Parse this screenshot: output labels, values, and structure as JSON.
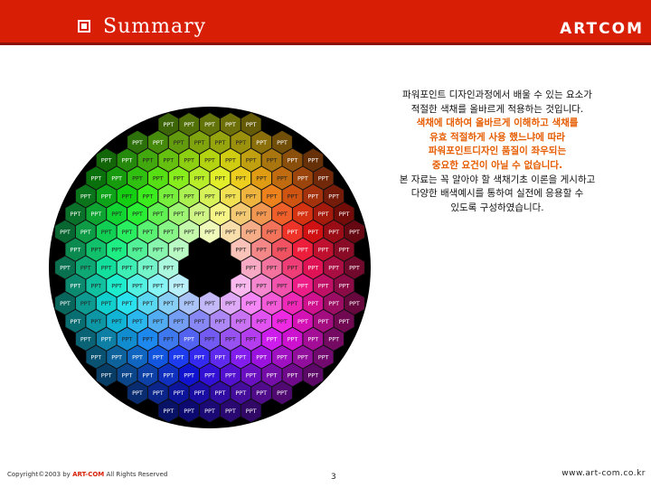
{
  "slide": {
    "title": "Summary",
    "brand": "ARTCOM",
    "cell_label": "PPT"
  },
  "summary": {
    "lines": [
      {
        "text": "파워포인트 디자인과정에서 배울 수 있는 요소가",
        "highlight": false
      },
      {
        "text": "적절한 색채를 올바르게 적용하는 것입니다.",
        "highlight": false
      },
      {
        "text": "색채에 대하여 올바르게 이해하고 색채를",
        "highlight": true
      },
      {
        "text": "유효 적절하게 사용 했느냐에 따라",
        "highlight": true
      },
      {
        "text": "파워포인트디자인 품질이 좌우되는",
        "highlight": true
      },
      {
        "text": "중요한 요건이 아닐 수 없습니다.",
        "highlight": true
      },
      {
        "text": "본 자료는 꼭 알아야 할 색채기초 이론을 게시하고",
        "highlight": false
      },
      {
        "text": "다양한 배색예시를 통하여 실전에 응용할 수",
        "highlight": false
      },
      {
        "text": "있도록 구성하였습니다.",
        "highlight": false
      }
    ]
  },
  "footer": {
    "copyright_prefix": "Copyright©2003 by ",
    "copyright_brand": "ART-COM",
    "copyright_suffix": " All Rights Reserved",
    "page": "3",
    "url": "www.art-com.co.kr"
  },
  "colors": {
    "header": "#d81e05",
    "highlight": "#e65c00"
  }
}
